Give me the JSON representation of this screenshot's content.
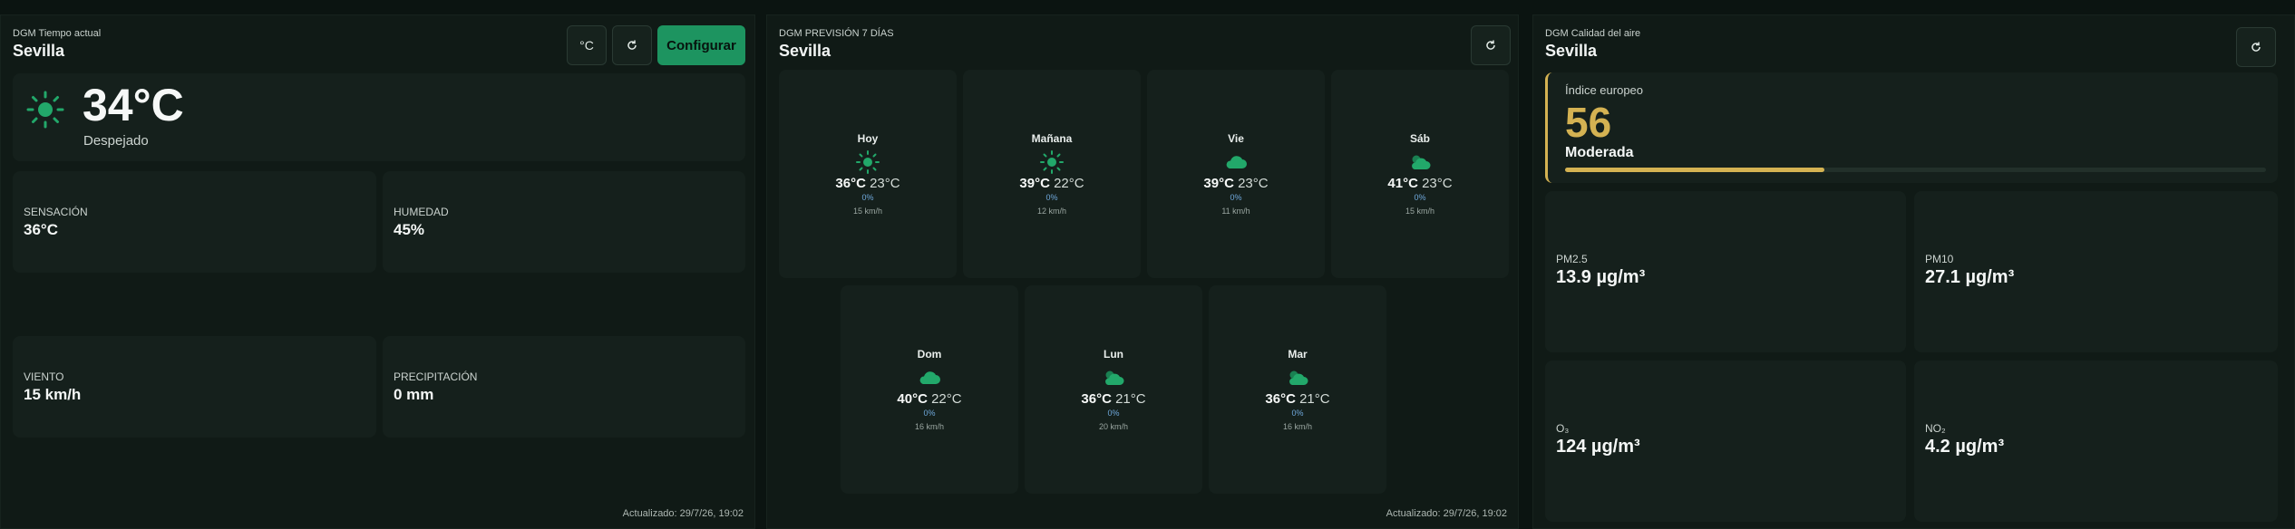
{
  "current": {
    "source": "DGM Tiempo actual",
    "city": "Sevilla",
    "unit_button": "°C",
    "refresh_icon": "refresh-icon",
    "configure_button": "Configurar",
    "temperature": "34°C",
    "condition": "Despejado",
    "condition_icon": "sun-icon",
    "stats": [
      {
        "label": "Sensación",
        "value": "36°C"
      },
      {
        "label": "Humedad",
        "value": "45%"
      },
      {
        "label": "Viento",
        "value": "15 km/h"
      },
      {
        "label": "Precipitación",
        "value": "0 mm"
      }
    ],
    "updated": "Actualizado: 29/7/26, 19:02"
  },
  "forecast": {
    "source": "DGM PREVISIÓN 7 DÍAS",
    "city": "Sevilla",
    "days": [
      {
        "name": "Hoy",
        "icon": "sun-icon",
        "max": "36°C",
        "min": "23°C",
        "precip": "0%",
        "wind": "15 km/h"
      },
      {
        "name": "Mañana",
        "icon": "sun-icon",
        "max": "39°C",
        "min": "22°C",
        "precip": "0%",
        "wind": "12 km/h"
      },
      {
        "name": "Vie",
        "icon": "cloud-icon",
        "max": "39°C",
        "min": "23°C",
        "precip": "0%",
        "wind": "11 km/h"
      },
      {
        "name": "Sáb",
        "icon": "partly-cloudy-icon",
        "max": "41°C",
        "min": "23°C",
        "precip": "0%",
        "wind": "15 km/h"
      },
      {
        "name": "Dom",
        "icon": "cloud-icon",
        "max": "40°C",
        "min": "22°C",
        "precip": "0%",
        "wind": "16 km/h"
      },
      {
        "name": "Lun",
        "icon": "partly-cloudy-icon",
        "max": "36°C",
        "min": "21°C",
        "precip": "0%",
        "wind": "20 km/h"
      },
      {
        "name": "Mar",
        "icon": "partly-cloudy-icon",
        "max": "36°C",
        "min": "21°C",
        "precip": "0%",
        "wind": "16 km/h"
      }
    ],
    "updated": "Actualizado: 29/7/26, 19:02"
  },
  "air": {
    "source": "DGM Calidad del aire",
    "city": "Sevilla",
    "index_label": "Índice europeo",
    "index_value": "56",
    "index_level": "Moderada",
    "index_fill_fraction": 0.37,
    "index_color": "#d4b252",
    "pollutants": [
      {
        "label": "PM2.5",
        "value": "13.9 µg/m³"
      },
      {
        "label": "PM10",
        "value": "27.1 µg/m³"
      },
      {
        "label": "O₃",
        "value": "124 µg/m³"
      },
      {
        "label": "NO₂",
        "value": "4.2 µg/m³"
      }
    ]
  },
  "colors": {
    "accent": "#1d9460",
    "icon": "#22a86a"
  }
}
